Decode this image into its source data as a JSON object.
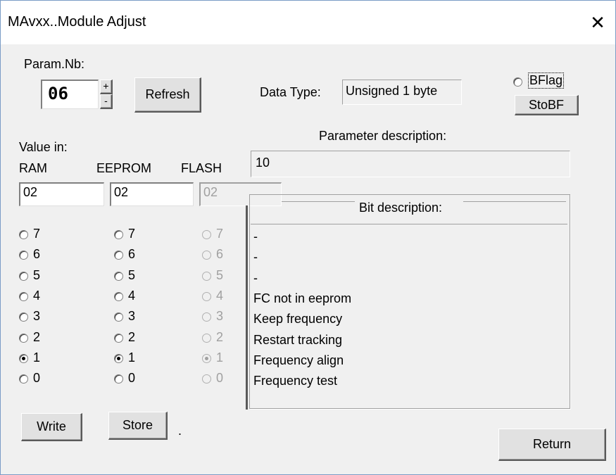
{
  "window": {
    "title": "MAvxx..Module Adjust",
    "close_glyph": "✕"
  },
  "param": {
    "label": "Param.Nb:",
    "value": "06",
    "inc": "+",
    "dec": "-",
    "refresh": "Refresh"
  },
  "datatype": {
    "label": "Data Type:",
    "value": "Unsigned 1 byte"
  },
  "bflag": {
    "label": "BFlag",
    "stobf": "StoBF",
    "checked": false
  },
  "param_desc": {
    "label": "Parameter description:",
    "value": "10"
  },
  "value_in": {
    "label": "Value in:",
    "ram": "RAM",
    "eeprom": "EEPROM",
    "flash": "FLASH"
  },
  "values": {
    "ram": "02",
    "eeprom": "02",
    "flash": "02"
  },
  "bits": [
    "7",
    "6",
    "5",
    "4",
    "3",
    "2",
    "1",
    "0"
  ],
  "selected_bit": "1",
  "bit_desc": {
    "label": "Bit description:",
    "rows": [
      "-",
      "-",
      "-",
      "FC not in eeprom",
      "Keep frequency",
      "Restart tracking",
      "Frequency align",
      "Frequency test"
    ]
  },
  "buttons": {
    "write": "Write",
    "store": "Store",
    "dot": ".",
    "return": "Return"
  }
}
